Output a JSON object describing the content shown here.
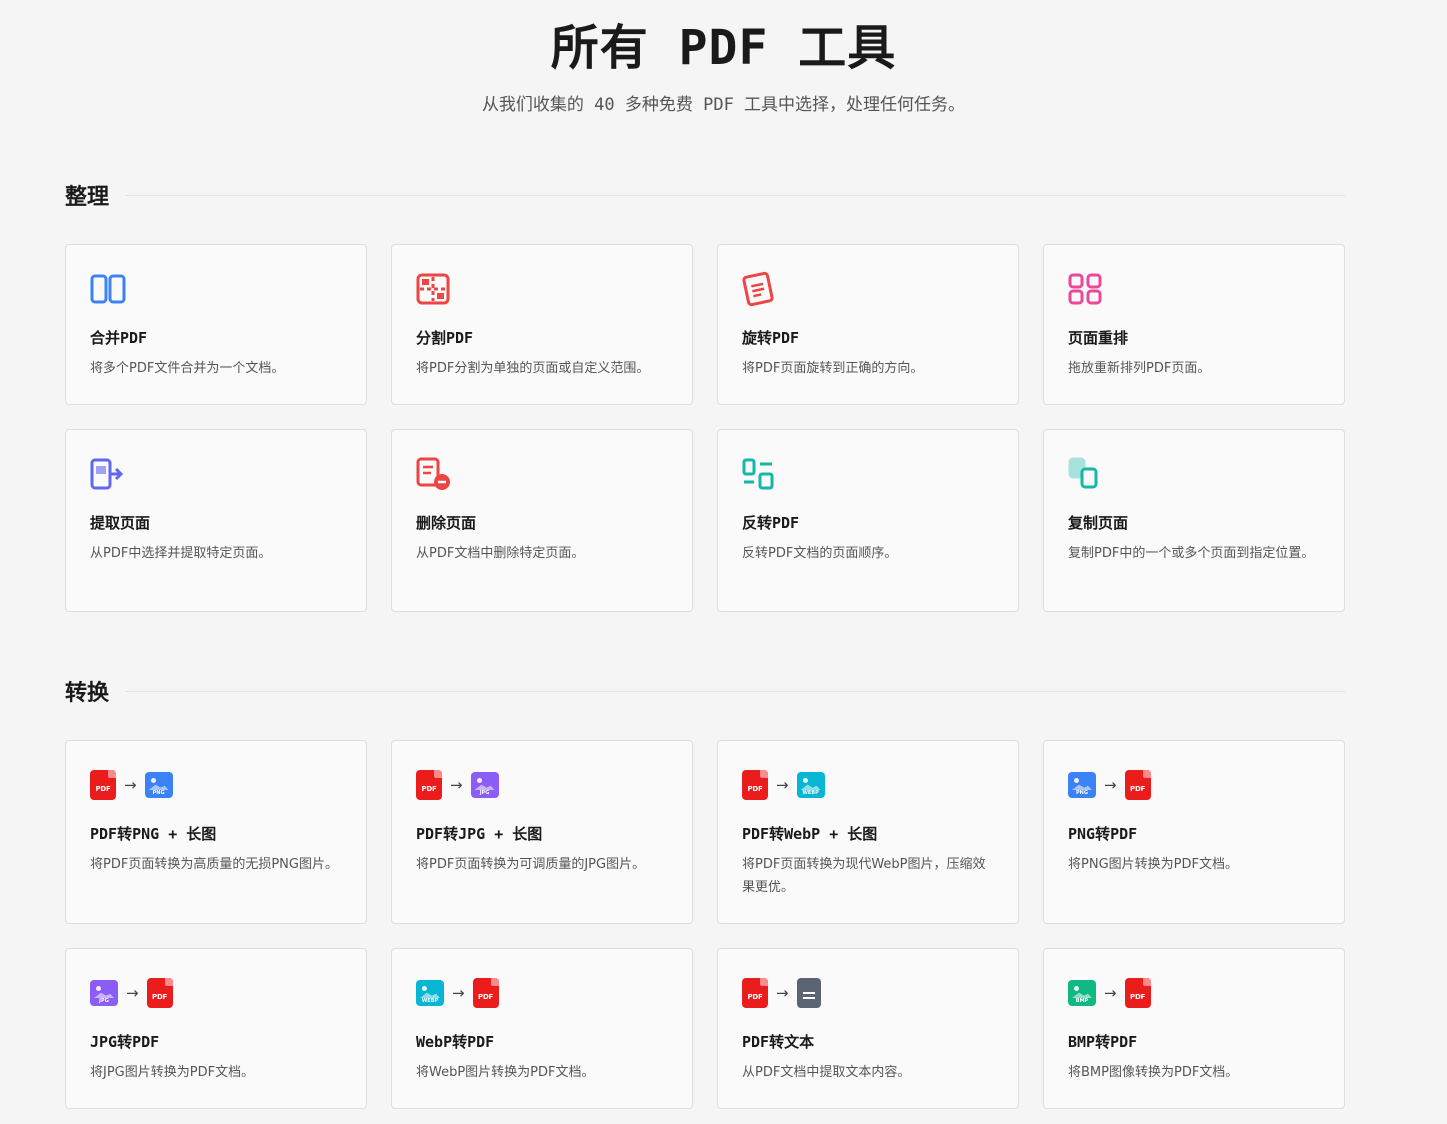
{
  "header": {
    "title": "所有 PDF 工具",
    "subtitle": "从我们收集的 40 多种免费 PDF 工具中选择，处理任何任务。"
  },
  "sections": [
    {
      "title": "整理",
      "tools": [
        {
          "name": "合并PDF",
          "desc": "将多个PDF文件合并为一个文档。",
          "icon": "merge-icon",
          "color": "#3b82f6"
        },
        {
          "name": "分割PDF",
          "desc": "将PDF分割为单独的页面或自定义范围。",
          "icon": "split-icon",
          "color": "#ef4444"
        },
        {
          "name": "旋转PDF",
          "desc": "将PDF页面旋转到正确的方向。",
          "icon": "rotate-icon",
          "color": "#ef4444"
        },
        {
          "name": "页面重排",
          "desc": "拖放重新排列PDF页面。",
          "icon": "reorder-icon",
          "color": "#ec4899"
        },
        {
          "name": "提取页面",
          "desc": "从PDF中选择并提取特定页面。",
          "icon": "extract-icon",
          "color": "#6366f1"
        },
        {
          "name": "删除页面",
          "desc": "从PDF文档中删除特定页面。",
          "icon": "delete-page-icon",
          "color": "#ef4444"
        },
        {
          "name": "反转PDF",
          "desc": "反转PDF文档的页面顺序。",
          "icon": "reverse-icon",
          "color": "#14b8a6"
        },
        {
          "name": "复制页面",
          "desc": "复制PDF中的一个或多个页面到指定位置。",
          "icon": "duplicate-icon",
          "color": "#14b8a6"
        }
      ]
    },
    {
      "title": "转换",
      "tools": [
        {
          "name": "PDF转PNG + 长图",
          "desc": "将PDF页面转换为高质量的无损PNG图片。",
          "from": "PDF",
          "to": "PNG"
        },
        {
          "name": "PDF转JPG + 长图",
          "desc": "将PDF页面转换为可调质量的JPG图片。",
          "from": "PDF",
          "to": "JPG"
        },
        {
          "name": "PDF转WebP + 长图",
          "desc": "将PDF页面转换为现代WebP图片，压缩效果更优。",
          "from": "PDF",
          "to": "WEBP"
        },
        {
          "name": "PNG转PDF",
          "desc": "将PNG图片转换为PDF文档。",
          "from": "PNG",
          "to": "PDF"
        },
        {
          "name": "JPG转PDF",
          "desc": "将JPG图片转换为PDF文档。",
          "from": "JPG",
          "to": "PDF"
        },
        {
          "name": "WebP转PDF",
          "desc": "将WebP图片转换为PDF文档。",
          "from": "WEBP",
          "to": "PDF"
        },
        {
          "name": "PDF转文本",
          "desc": "从PDF文档中提取文本内容。",
          "from": "PDF",
          "to": "TXT"
        },
        {
          "name": "BMP转PDF",
          "desc": "将BMP图像转换为PDF文档。",
          "from": "BMP",
          "to": "PDF"
        }
      ]
    }
  ]
}
